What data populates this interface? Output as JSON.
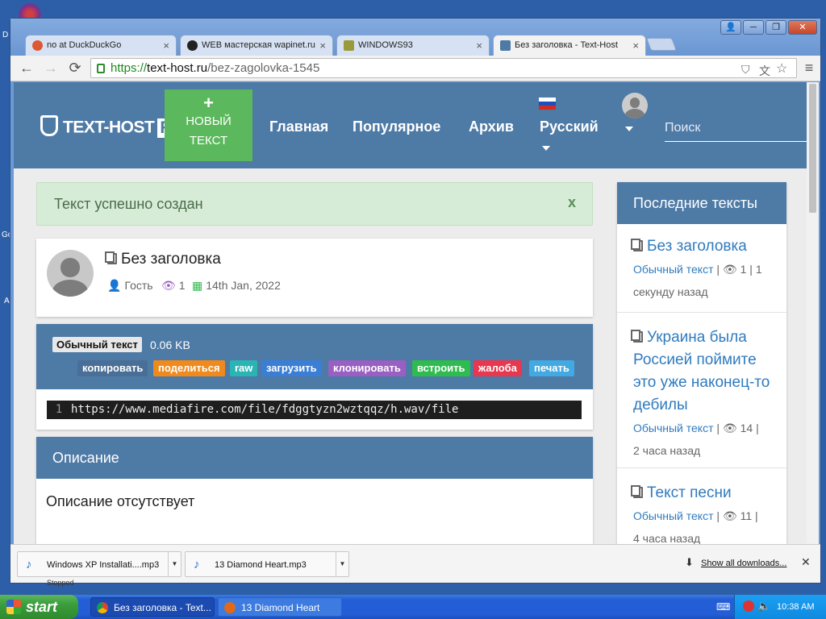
{
  "desktop": {
    "fragments": [
      "D",
      "Go",
      "A"
    ]
  },
  "window": {
    "controls": [
      "👤",
      "─",
      "❐",
      "✕"
    ],
    "tabs": [
      {
        "label": "no at DuckDuckGo",
        "active": false
      },
      {
        "label": "WEB мастерская wapinet.ru",
        "active": false
      },
      {
        "label": "WINDOWS93",
        "active": false
      },
      {
        "label": "Без заголовка - Text-Host",
        "active": true
      }
    ]
  },
  "toolbar": {
    "back": "←",
    "forward": "→",
    "reload": "⟳",
    "url_scheme": "https://",
    "url_host": "text-host.ru",
    "url_path": "/bez-zagolovka-1545",
    "menu": "≡"
  },
  "site": {
    "logo_text": "TEXT-HOST",
    "logo_badge": "RU",
    "new_button_plus": "+",
    "new_button_line1": "НОВЫЙ",
    "new_button_line2": "ТЕКСТ",
    "nav": [
      "Главная",
      "Популярное",
      "Архив",
      "Русский"
    ],
    "search_placeholder": "Поиск"
  },
  "alert": {
    "text": "Текст успешно создан",
    "close": "x"
  },
  "post": {
    "title": "Без заголовка",
    "author": "Гость",
    "views": "1",
    "date": "14th Jan, 2022"
  },
  "code": {
    "type": "Обычный текст",
    "size": "0.06 KB",
    "actions": [
      {
        "label": "копировать",
        "color": "#4a6f97"
      },
      {
        "label": "поделиться",
        "color": "#f08a1c"
      },
      {
        "label": "raw",
        "color": "#2bb4b4"
      },
      {
        "label": "загрузить",
        "color": "#3a7fd5"
      },
      {
        "label": "клонировать",
        "color": "#9a5fc2"
      },
      {
        "label": "встроить",
        "color": "#2ebc4f"
      },
      {
        "label": "жалоба",
        "color": "#e8374f"
      },
      {
        "label": "печать",
        "color": "#42a9e3"
      }
    ],
    "line_number": "1",
    "line": "https://www.mediafire.com/file/fdggtyzn2wztqqz/h.wav/file"
  },
  "description": {
    "heading": "Описание",
    "text": "Описание отсутствует"
  },
  "sidebar": {
    "heading": "Последние тексты",
    "items": [
      {
        "title": "Без заголовка",
        "type": "Обычный текст",
        "views": "1",
        "time_a": "1",
        "time_b": "секунду назад"
      },
      {
        "title": "Украина была Россией поймите это уже наконец-то дебилы",
        "type": "Обычный текст",
        "views": "14",
        "time_a": "",
        "time_b": "2 часа назад"
      },
      {
        "title": "Текст песни",
        "type": "Обычный текст",
        "views": "11",
        "time_a": "",
        "time_b": "4 часа назад"
      }
    ]
  },
  "downloads": {
    "items": [
      "Windows XP Installati....mp3",
      "13 Diamond Heart.mp3"
    ],
    "show_all": "Show all downloads...",
    "close": "✕",
    "status": "Stopped"
  },
  "taskbar": {
    "start": "start",
    "tasks": [
      "Без заголовка - Text...",
      "13 Diamond Heart"
    ],
    "clock": "10:38 AM"
  }
}
